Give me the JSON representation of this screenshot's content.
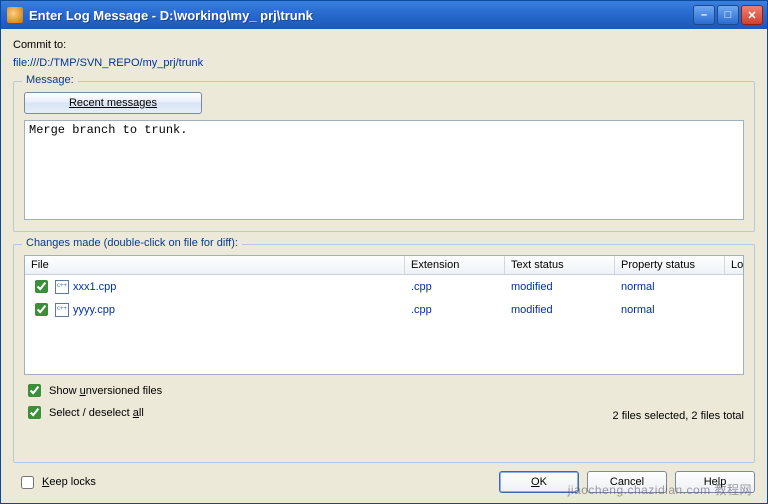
{
  "window": {
    "title": "Enter Log Message - D:\\working\\my_ prj\\trunk"
  },
  "commit": {
    "label": "Commit to:",
    "url": "file:///D:/TMP/SVN_REPO/my_prj/trunk"
  },
  "message": {
    "legend": "Message:",
    "recent_btn_full": "Recent messages",
    "recent_btn_prefix": "R",
    "recent_btn_ul": "e",
    "recent_btn_suffix": "cent messages",
    "value": "Merge branch to trunk."
  },
  "changes": {
    "legend": "Changes made (double-click on file for diff):",
    "columns": {
      "file": "File",
      "extension": "Extension",
      "text_status": "Text status",
      "property_status": "Property status",
      "lock": "Lock"
    },
    "rows": [
      {
        "checked": true,
        "name": "xxx1.cpp",
        "ext": ".cpp",
        "text_status": "modified",
        "prop_status": "normal",
        "lock": ""
      },
      {
        "checked": true,
        "name": "yyyy.cpp",
        "ext": ".cpp",
        "text_status": "modified",
        "prop_status": "normal",
        "lock": ""
      }
    ],
    "summary": "2 files selected, 2 files total",
    "show_unversioned": {
      "checked": true,
      "prefix": "Show ",
      "ul": "u",
      "suffix": "nversioned files"
    },
    "select_all": {
      "checked": true,
      "prefix": "Select / deselect ",
      "ul": "a",
      "suffix": "ll"
    }
  },
  "keep_locks": {
    "checked": false,
    "prefix": "",
    "ul": "K",
    "suffix": "eep locks"
  },
  "buttons": {
    "ok_prefix": "",
    "ok_ul": "O",
    "ok_suffix": "K",
    "cancel": "Cancel",
    "help": "Help"
  },
  "watermark": "jiaocheng.chazidian.com  教程网"
}
